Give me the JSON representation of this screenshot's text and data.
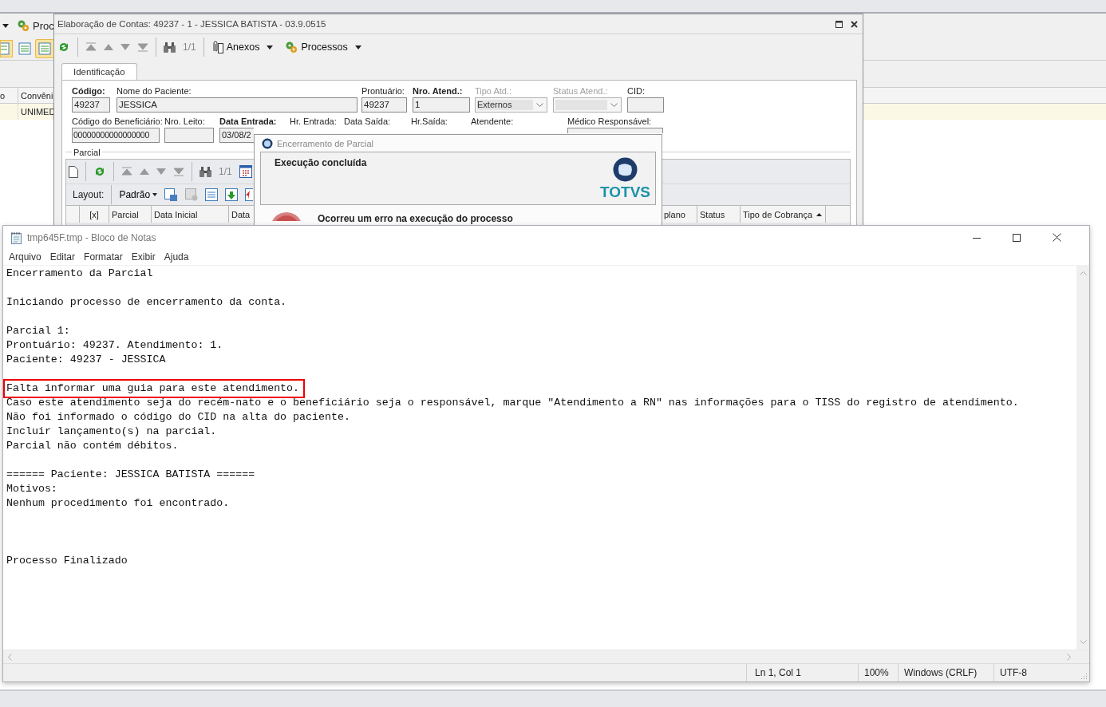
{
  "background_app": {
    "toolbar_label": "Proc",
    "table": {
      "columns": [
        "o",
        "Convêni"
      ],
      "row_value": "UNIMED"
    }
  },
  "main_window": {
    "title": "Elaboração de Contas: 49237 - 1 - JESSICA BATISTA - 03.9.0515",
    "toolbar": {
      "record_counter": "1/1",
      "menus": [
        "Anexos",
        "Processos"
      ]
    },
    "tabs": [
      {
        "label": "Identificação",
        "selected": true
      }
    ],
    "fields_row_1": [
      {
        "label": "Código:",
        "value": "49237",
        "bold": true,
        "disabled": false,
        "kind": "text"
      },
      {
        "label": "Nome do Paciente:",
        "value": "JESSICA",
        "bold": false,
        "disabled": false,
        "kind": "text"
      },
      {
        "label": "Prontuário:",
        "value": "49237",
        "bold": false,
        "disabled": false,
        "kind": "text"
      },
      {
        "label": "Nro. Atend.:",
        "value": "1",
        "bold": true,
        "disabled": false,
        "kind": "text"
      },
      {
        "label": "Tipo Atd.:",
        "value": "Externos",
        "bold": false,
        "disabled": true,
        "kind": "select"
      },
      {
        "label": "Status Atend.:",
        "bold": false,
        "disabled": true,
        "kind": "select"
      },
      {
        "label": "CID:",
        "bold": false,
        "disabled": false,
        "kind": "text"
      }
    ],
    "fields_row_2": [
      {
        "label": "Código do Beneficiário:",
        "value": "00000000000000000",
        "bold": false,
        "disabled": false,
        "kind": "text"
      },
      {
        "label": "Nro. Leito:",
        "bold": false,
        "disabled": false,
        "kind": "text"
      },
      {
        "label": "Data Entrada:",
        "value": "03/08/2",
        "bold": true,
        "disabled": false,
        "kind": "text"
      },
      {
        "label": "Hr. Entrada:",
        "bold": false,
        "disabled": false,
        "kind": "label"
      },
      {
        "label": "Data Saída:",
        "bold": false,
        "disabled": false,
        "kind": "label"
      },
      {
        "label": "Hr.Saída:",
        "bold": false,
        "disabled": false,
        "kind": "label"
      },
      {
        "label": "Atendente:",
        "bold": false,
        "disabled": false,
        "kind": "label"
      },
      {
        "label": "Médico Responsável:",
        "bold": false,
        "disabled": false,
        "kind": "text"
      }
    ],
    "parcial": {
      "title": "Parcial",
      "record_counter": "1/1",
      "layout_label": "Layout:",
      "layout_menu": "Padrão",
      "columns_left": [
        "[x]",
        "Parcial",
        "Data Inicial",
        "Data"
      ],
      "columns_right": [
        {
          "label": "plano",
          "sorted": false
        },
        {
          "label": "Status",
          "sorted": false
        },
        {
          "label": "Tipo de Cobrança",
          "sorted": true
        }
      ]
    }
  },
  "dialog": {
    "title": "Encerramento de Parcial",
    "message": "Execução concluída",
    "logo_text": "TOTVS",
    "error": "Ocorreu um erro na execução do processo"
  },
  "notepad": {
    "title": "tmp645F.tmp - Bloco de Notas",
    "menu": [
      "Arquivo",
      "Editar",
      "Formatar",
      "Exibir",
      "Ajuda"
    ],
    "blocks": [
      {
        "kind": "text",
        "lines": [
          {
            "text": "Encerramento da Parcial",
            "marked": false
          }
        ]
      },
      {
        "kind": "text",
        "lines": [
          {
            "text": "Iniciando processo de encerramento da conta.",
            "marked": false
          }
        ]
      },
      {
        "kind": "text",
        "lines": [
          {
            "text": "Parcial 1:",
            "marked": false
          },
          {
            "text": "Prontuário: 49237. Atendimento: 1.",
            "marked": false
          },
          {
            "text": "Paciente: 49237 - JESSICA",
            "marked": false
          }
        ]
      },
      {
        "kind": "text",
        "lines": [
          {
            "text": "Falta informar uma guia para este atendimento.",
            "marked": true
          },
          {
            "text": "Caso este atendimento seja do recém-nato e o beneficiário seja o responsável, marque \"Atendimento a RN\" nas informações para o TISS do registro de atendimento.",
            "marked": false
          },
          {
            "text": "Não foi informado o código do CID na alta do paciente.",
            "marked": false
          },
          {
            "text": "Incluir lançamento(s) na parcial.",
            "marked": false
          },
          {
            "text": "Parcial não contém débitos.",
            "marked": false
          }
        ]
      },
      {
        "kind": "text",
        "lines": [
          {
            "text": "====== Paciente: JESSICA BATISTA ======",
            "marked": false
          },
          {
            "text": "Motivos:",
            "marked": false
          },
          {
            "text": "Nenhum procedimento foi encontrado.",
            "marked": false
          }
        ]
      },
      {
        "kind": "closing",
        "lines": [
          {
            "text": "Processo Finalizado",
            "marked": false
          }
        ]
      }
    ],
    "status_bar": {
      "position": "Ln 1, Col 1",
      "zoom": "100%",
      "line_ending": "Windows (CRLF)",
      "encoding": "UTF-8"
    }
  }
}
